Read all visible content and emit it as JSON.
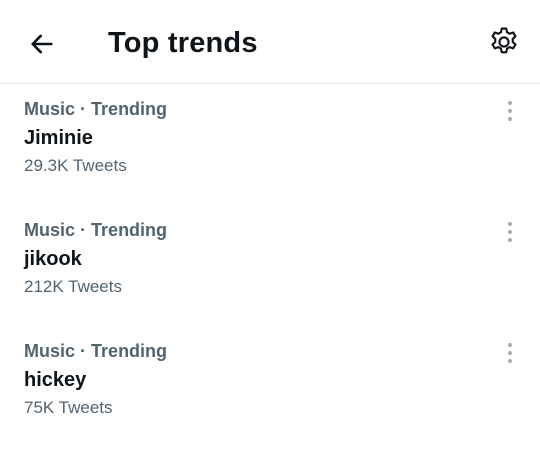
{
  "header": {
    "title": "Top trends",
    "back_icon": "arrow-left-icon",
    "settings_icon": "gear-icon"
  },
  "trends": [
    {
      "category": "Music",
      "separator": "·",
      "status": "Trending",
      "name": "Jiminie",
      "tweets": "29.3K Tweets"
    },
    {
      "category": "Music",
      "separator": "·",
      "status": "Trending",
      "name": "jikook",
      "tweets": "212K Tweets"
    },
    {
      "category": "Music",
      "separator": "·",
      "status": "Trending",
      "name": "hickey",
      "tweets": "75K Tweets"
    }
  ],
  "colors": {
    "text_primary": "#0f1419",
    "text_secondary": "#536471",
    "divider": "#e6e9eb",
    "icon_muted": "#a4b1bb"
  }
}
